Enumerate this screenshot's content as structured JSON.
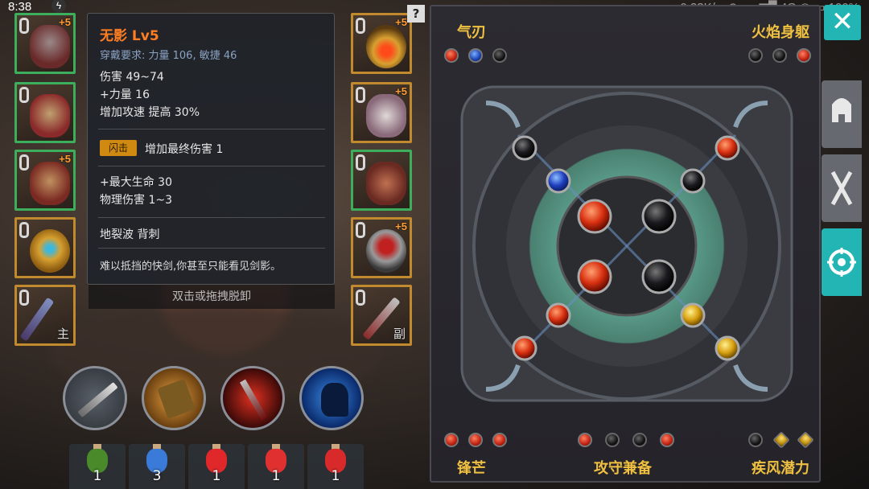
{
  "status_bar": {
    "time": "8:38",
    "network": "0.23K/s",
    "signal": "4G",
    "battery": "100%"
  },
  "equipment": {
    "left": [
      {
        "name": "helmet-slot",
        "plus": "+5",
        "tag": "",
        "color": "green"
      },
      {
        "name": "chest-slot",
        "plus": "",
        "tag": "",
        "color": "green"
      },
      {
        "name": "armor-slot",
        "plus": "+5",
        "tag": "",
        "color": "green"
      },
      {
        "name": "ring-slot",
        "plus": "",
        "tag": "",
        "color": "gold"
      },
      {
        "name": "main-weapon-slot",
        "plus": "",
        "tag": "主",
        "color": "gold"
      }
    ],
    "right": [
      {
        "name": "necklace-slot",
        "plus": "+5",
        "tag": "",
        "color": "gold"
      },
      {
        "name": "gloves-slot",
        "plus": "+5",
        "tag": "",
        "color": "gold"
      },
      {
        "name": "boots-slot",
        "plus": "",
        "tag": "",
        "color": "green"
      },
      {
        "name": "bracer-slot",
        "plus": "+5",
        "tag": "",
        "color": "gold"
      },
      {
        "name": "off-weapon-slot",
        "plus": "",
        "tag": "副",
        "color": "gold"
      }
    ]
  },
  "tooltip": {
    "title": "无影 Lv5",
    "requirement": "穿戴要求:   力量 106, 敏捷 46",
    "stats": [
      "伤害   49~74",
      "+力量 16",
      "增加攻速 提高 30%"
    ],
    "flash_badge": "闪击",
    "flash_text": "增加最终伤害 1",
    "bonus": [
      "+最大生命 30",
      "物理伤害 1~3"
    ],
    "skills": "地裂波    背刺",
    "flavor": "难以抵挡的快剑,你甚至只能看见剑影。",
    "unequip": "双击或拖拽脱卸"
  },
  "potions": [
    {
      "color": "#4a8a2a",
      "count": "1"
    },
    {
      "color": "#3a7ad8",
      "count": "3"
    },
    {
      "color": "#e0282a",
      "count": "1"
    },
    {
      "color": "#e03030",
      "count": "1"
    },
    {
      "color": "#d82a2a",
      "count": "1"
    }
  ],
  "gem_panel": {
    "set_top_left": "气刃",
    "set_top_right": "火焰身躯",
    "set_bottom_left": "锋芒",
    "set_bottom_center": "攻守兼备",
    "set_bottom_right": "疾风潜力",
    "top_left_gems": [
      "red",
      "blue",
      "black"
    ],
    "top_right_gems": [
      "black",
      "black",
      "red"
    ],
    "bottom_left_gems": [
      "red",
      "red",
      "red"
    ],
    "bottom_center_gems": [
      "red",
      "black",
      "black",
      "red"
    ],
    "bottom_right_gems": [
      "black",
      "yellow",
      "yellow"
    ]
  },
  "help_icon": "?",
  "close_label": "✕",
  "colors": {
    "accent_teal": "#23b5b3",
    "title_orange": "#ff7e22",
    "set_gold": "#f0c040"
  }
}
